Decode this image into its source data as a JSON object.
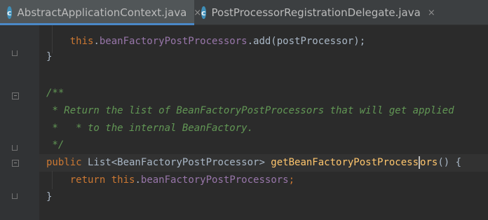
{
  "tabs": [
    {
      "label": "AbstractApplicationContext.java",
      "icon": "java-class-icon",
      "icon_letter": "c",
      "active": true
    },
    {
      "label": "PostProcessorRegistrationDelegate.java",
      "icon": "java-class-icon",
      "icon_letter": "c",
      "active": false
    }
  ],
  "close_glyph": "×",
  "code": {
    "l0": "    this.beanFactoryPostProcessors.add(postProcessor);",
    "l0_kw": "this",
    "l0_dot": ".",
    "l0_field": "beanFactoryPostProcessors",
    "l0_rest": ".add(postProcessor);",
    "l1": "}",
    "l2": "/**",
    "l3": " * Return the list of BeanFactoryPostProcessors that will get applied",
    "l4": " *   * to the internal BeanFactory.",
    "l5": " */",
    "l6_kw": "public",
    "l6_type": " List<BeanFactoryPostProcessor> ",
    "l6_method_a": "getBeanFactoryPostProcess",
    "l6_method_b": "ors",
    "l6_rest": "() {",
    "l7_kw_a": "return",
    "l7_kw_b": "this",
    "l7_dot": ".",
    "l7_field": "beanFactoryPostProcessors",
    "l7_semi": ";",
    "l8": "}"
  },
  "colors": {
    "keyword": "#cc7832",
    "field": "#9876aa",
    "method": "#ffc66d",
    "comment": "#629755",
    "text": "#a9b7c6",
    "background": "#2b2b2b",
    "tab_accent": "#4a88c7"
  }
}
